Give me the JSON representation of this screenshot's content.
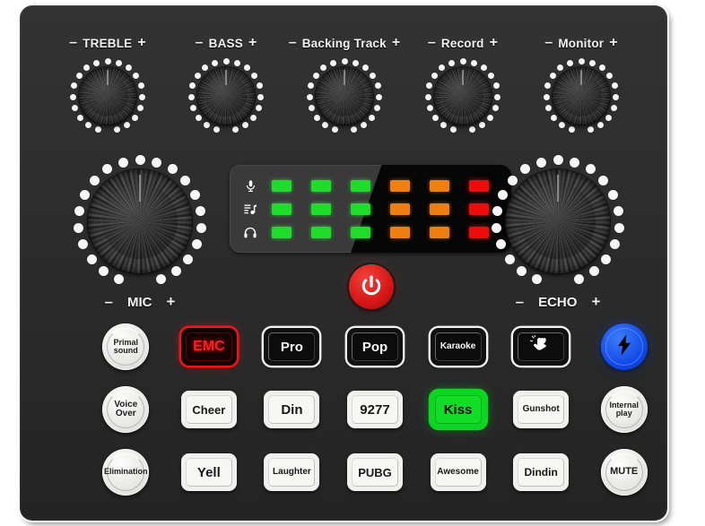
{
  "device": {
    "name": "live-sound-card-mixer",
    "panel_color": "#2c2c2c",
    "frame_color": "#ffffff"
  },
  "top_knobs": [
    {
      "minus": "–",
      "label": "TREBLE",
      "plus": "+",
      "icon": "rotary-knob-icon"
    },
    {
      "minus": "–",
      "label": "BASS",
      "plus": "+",
      "icon": "rotary-knob-icon"
    },
    {
      "minus": "–",
      "label": "Backing Track",
      "plus": "+",
      "icon": "rotary-knob-icon"
    },
    {
      "minus": "–",
      "label": "Record",
      "plus": "+",
      "icon": "rotary-knob-icon"
    },
    {
      "minus": "–",
      "label": "Monitor",
      "plus": "+",
      "icon": "rotary-knob-icon"
    }
  ],
  "big_knobs": [
    {
      "minus": "–",
      "label": "MIC",
      "plus": "+"
    },
    {
      "minus": "–",
      "label": "ECHO",
      "plus": "+"
    }
  ],
  "led_panel": {
    "rows": [
      {
        "icon": "microphone-icon",
        "leds": [
          "green",
          "green",
          "green",
          "orange",
          "orange",
          "red"
        ]
      },
      {
        "icon": "music-list-icon",
        "leds": [
          "green",
          "green",
          "green",
          "orange",
          "orange",
          "red"
        ]
      },
      {
        "icon": "headphones-icon",
        "leds": [
          "green",
          "green",
          "green",
          "orange",
          "orange",
          "red"
        ]
      }
    ],
    "colors": {
      "green": "#1fdc2b",
      "orange": "#ee7f10",
      "red": "#ee0b0b"
    }
  },
  "power_button": {
    "label": "",
    "icon": "power-icon",
    "color": "#d41515"
  },
  "pads": {
    "row1": [
      {
        "label": "Primal sound",
        "shape": "round",
        "style": "light",
        "size": "sz-9",
        "name": "pad-primal-sound"
      },
      {
        "label": "EMC",
        "shape": "square",
        "style": "red",
        "size": "sz-16",
        "name": "pad-emc"
      },
      {
        "label": "Pro",
        "shape": "square",
        "style": "dark",
        "size": "sz-15",
        "name": "pad-pro"
      },
      {
        "label": "Pop",
        "shape": "square",
        "style": "dark",
        "size": "sz-15",
        "name": "pad-pop"
      },
      {
        "label": "Karaoke",
        "shape": "square",
        "style": "dark",
        "size": "sz-10",
        "name": "pad-karaoke"
      },
      {
        "label": "",
        "shape": "square",
        "style": "dark",
        "size": "sz-12",
        "name": "pad-applause-icon",
        "icon": "applause-icon"
      },
      {
        "label": "",
        "shape": "round",
        "style": "blue",
        "size": "sz-12",
        "name": "pad-lightning",
        "icon": "lightning-bolt-icon"
      }
    ],
    "row2": [
      {
        "label": "Voice Over",
        "shape": "round",
        "style": "light",
        "size": "sz-10",
        "name": "pad-voice-over"
      },
      {
        "label": "Cheer",
        "shape": "square",
        "style": "light",
        "size": "sz-13",
        "name": "pad-cheer"
      },
      {
        "label": "Din",
        "shape": "square",
        "style": "light",
        "size": "sz-15",
        "name": "pad-din"
      },
      {
        "label": "9277",
        "shape": "square",
        "style": "light",
        "size": "sz-15",
        "name": "pad-9277"
      },
      {
        "label": "Kiss",
        "shape": "square",
        "style": "green",
        "size": "sz-15",
        "name": "pad-kiss"
      },
      {
        "label": "Gunshot",
        "shape": "square",
        "style": "light",
        "size": "sz-10",
        "name": "pad-gunshot"
      },
      {
        "label": "Internal play",
        "shape": "round",
        "style": "light",
        "size": "sz-9",
        "name": "pad-internal-play"
      }
    ],
    "row3": [
      {
        "label": "Elimination",
        "shape": "round",
        "style": "light",
        "size": "sz-9",
        "name": "pad-elimination"
      },
      {
        "label": "Yell",
        "shape": "square",
        "style": "light",
        "size": "sz-15",
        "name": "pad-yell"
      },
      {
        "label": "Laughter",
        "shape": "square",
        "style": "light",
        "size": "sz-10",
        "name": "pad-laughter"
      },
      {
        "label": "PUBG",
        "shape": "square",
        "style": "light",
        "size": "sz-13",
        "name": "pad-pubg"
      },
      {
        "label": "Awesome",
        "shape": "square",
        "style": "light",
        "size": "sz-10",
        "name": "pad-awesome"
      },
      {
        "label": "Dindin",
        "shape": "square",
        "style": "light",
        "size": "sz-12",
        "name": "pad-dindin"
      },
      {
        "label": "MUTE",
        "shape": "round",
        "style": "light",
        "size": "sz-11",
        "name": "pad-mute"
      }
    ]
  }
}
